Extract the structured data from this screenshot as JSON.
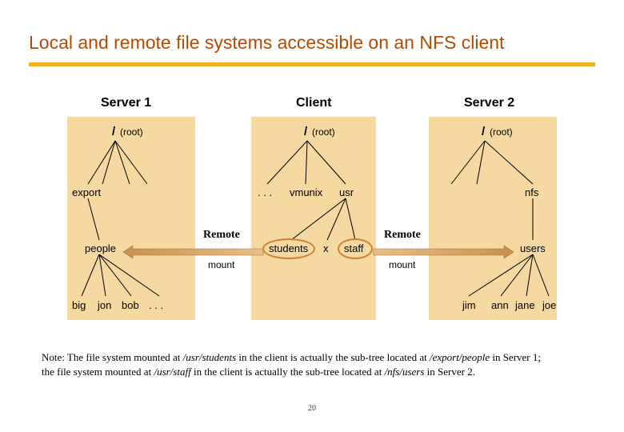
{
  "title": "Local and remote file systems accessible on an NFS client",
  "panels": {
    "server1": {
      "label": "Server 1",
      "root": "/",
      "root_paren": "(root)"
    },
    "client": {
      "label": "Client",
      "root": "/",
      "root_paren": "(root)"
    },
    "server2": {
      "label": "Server 2",
      "root": "/",
      "root_paren": "(root)"
    }
  },
  "server1": {
    "l1_export": "export",
    "l2_people": "people",
    "l3_big": "big",
    "l3_jon": "jon",
    "l3_bob": "bob",
    "l3_dots": ". . ."
  },
  "client": {
    "l1_dots": ". . .",
    "l1_vmunix": "vmunix",
    "l1_usr": "usr",
    "l2_students": "students",
    "l2_x": "x",
    "l2_staff": "staff"
  },
  "server2": {
    "l1_nfs": "nfs",
    "l2_users": "users",
    "l3_jim": "jim",
    "l3_ann": "ann",
    "l3_jane": "jane",
    "l3_joe": "joe"
  },
  "mount": {
    "remote": "Remote",
    "mount": "mount"
  },
  "note": {
    "prefix": "Note: The file system mounted at ",
    "p1": "/usr/students",
    "m1": " in the client is actually the sub-tree located at ",
    "p2": "/export/people",
    "m2": " in Server 1;",
    "line2a": "the file system mounted at ",
    "p3": "/usr/staff",
    "m3": " in the client is actually the sub-tree located at ",
    "p4": "/nfs/users",
    "m4": " in Server 2."
  },
  "page": "20"
}
